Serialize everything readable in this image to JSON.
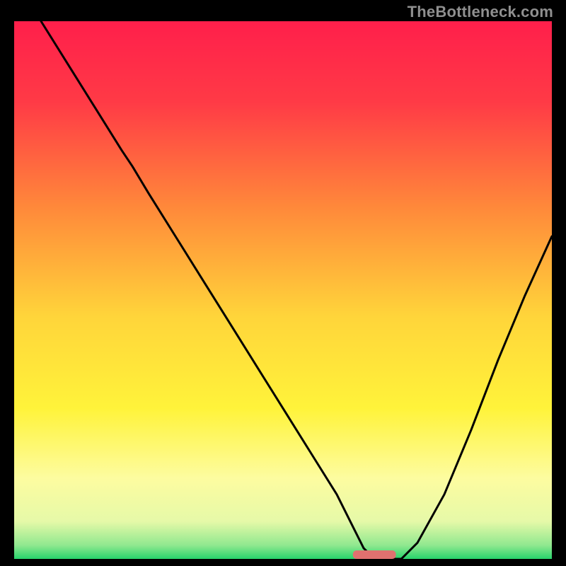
{
  "watermark": "TheBottleneck.com",
  "chart_data": {
    "type": "line",
    "title": "",
    "xlabel": "",
    "ylabel": "",
    "xlim": [
      0,
      100
    ],
    "ylim": [
      0,
      100
    ],
    "grid": false,
    "legend": false,
    "background_gradient_stops": [
      {
        "pos": 0.0,
        "color": "#ff1f4b"
      },
      {
        "pos": 0.15,
        "color": "#ff3a46"
      },
      {
        "pos": 0.35,
        "color": "#ff8a3a"
      },
      {
        "pos": 0.55,
        "color": "#ffd53a"
      },
      {
        "pos": 0.72,
        "color": "#fff33a"
      },
      {
        "pos": 0.85,
        "color": "#fdfca0"
      },
      {
        "pos": 0.93,
        "color": "#e6f9a8"
      },
      {
        "pos": 0.975,
        "color": "#8fe88f"
      },
      {
        "pos": 1.0,
        "color": "#27d36b"
      }
    ],
    "series": [
      {
        "name": "bottleneck-curve",
        "color": "#000000",
        "x": [
          5,
          10,
          15,
          20,
          22,
          25,
          30,
          35,
          40,
          45,
          50,
          55,
          60,
          63,
          65,
          67,
          70,
          72,
          75,
          80,
          85,
          90,
          95,
          100
        ],
        "y": [
          100,
          92,
          84,
          76,
          73,
          68,
          60,
          52,
          44,
          36,
          28,
          20,
          12,
          6,
          2,
          0,
          0,
          0,
          3,
          12,
          24,
          37,
          49,
          60
        ]
      }
    ],
    "valley_marker": {
      "color": "#e0716f",
      "x_start": 63,
      "x_end": 71,
      "y": 0
    }
  }
}
